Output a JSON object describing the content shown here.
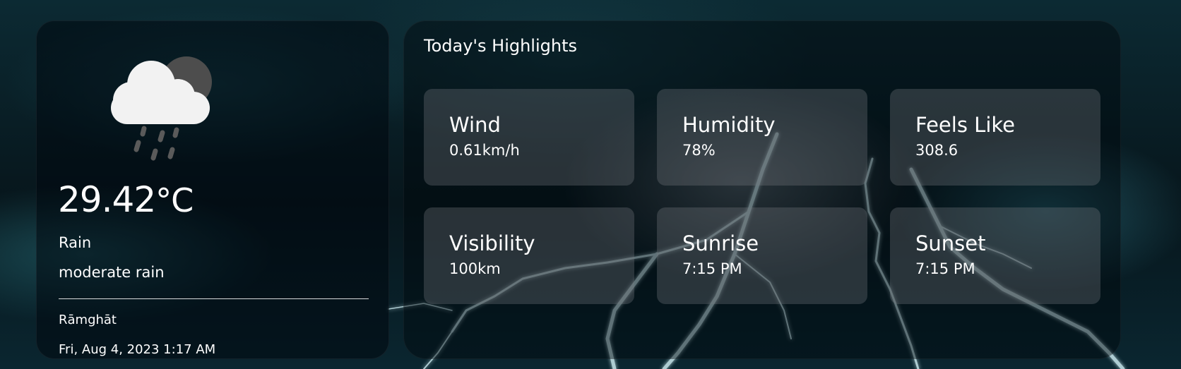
{
  "current": {
    "icon": "rain-cloud-moon-icon",
    "temperature": "29.42",
    "unit": "°C",
    "condition": "Rain",
    "description": "moderate rain",
    "location": "Rāmghāt",
    "datetime": "Fri, Aug 4, 2023 1:17 AM"
  },
  "highlights": {
    "title": "Today's Highlights",
    "items": [
      {
        "label": "Wind",
        "value": "0.61km/h"
      },
      {
        "label": "Humidity",
        "value": "78%"
      },
      {
        "label": "Feels Like",
        "value": "308.6"
      },
      {
        "label": "Visibility",
        "value": "100km"
      },
      {
        "label": "Sunrise",
        "value": "7:15 PM"
      },
      {
        "label": "Sunset",
        "value": "7:15 PM"
      }
    ]
  },
  "colors": {
    "background": "#07161c",
    "tile": "#7a7f84",
    "lightning": "#bfeff8"
  }
}
